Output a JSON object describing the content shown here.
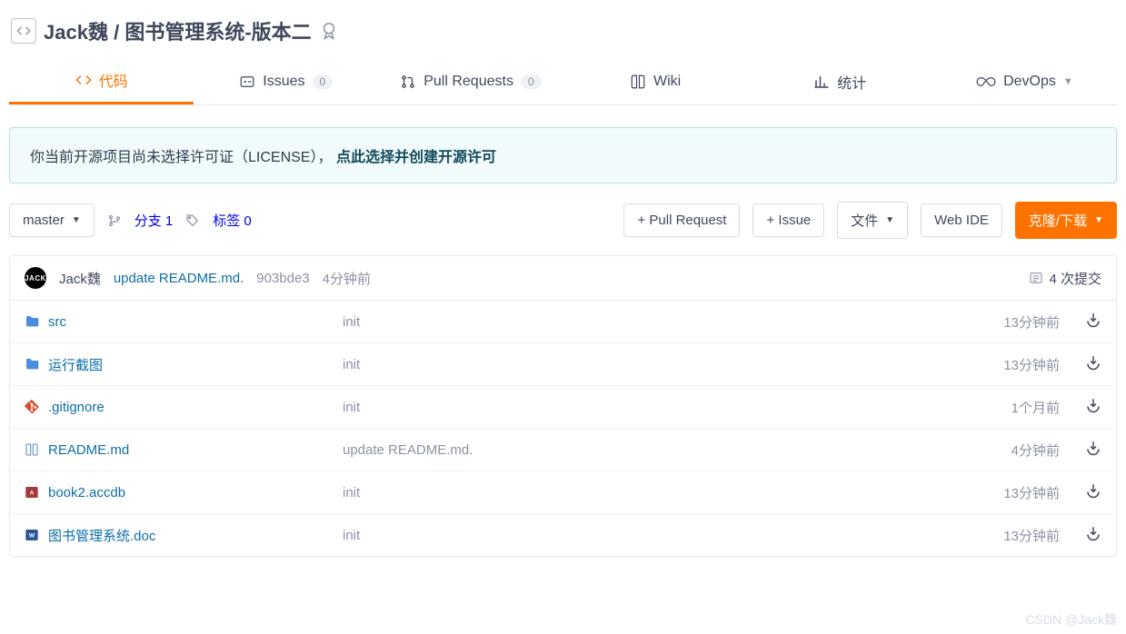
{
  "repo": {
    "owner": "Jack魏",
    "sep": "/",
    "name": "图书管理系统-版本二"
  },
  "tabs": {
    "code": "代码",
    "issues": "Issues",
    "issues_count": "0",
    "pr": "Pull Requests",
    "pr_count": "0",
    "wiki": "Wiki",
    "stats": "统计",
    "devops": "DevOps"
  },
  "notice": {
    "prefix": "你当前开源项目尚未选择许可证（LICENSE），",
    "action": "点此选择并创建开源许可"
  },
  "toolbar": {
    "branch_btn": "master",
    "branches_label": "分支 1",
    "tags_label": "标签 0",
    "new_pr": "+ Pull Request",
    "new_issue": "+ Issue",
    "files_btn": "文件",
    "webide": "Web IDE",
    "clone": "克隆/下载"
  },
  "latest": {
    "avatar_text": "JACK",
    "author": "Jack魏",
    "message": "update README.md.",
    "sha": "903bde3",
    "ago": "4分钟前",
    "commits_label": "4 次提交"
  },
  "files": [
    {
      "icon": "folder",
      "name": "src",
      "msg": "init",
      "time": "13分钟前"
    },
    {
      "icon": "folder",
      "name": "运行截图",
      "msg": "init",
      "time": "13分钟前"
    },
    {
      "icon": "git",
      "name": ".gitignore",
      "msg": "init",
      "time": "1个月前"
    },
    {
      "icon": "readme",
      "name": "README.md",
      "msg": "update README.md.",
      "time": "4分钟前"
    },
    {
      "icon": "access",
      "name": "book2.accdb",
      "msg": "init",
      "time": "13分钟前"
    },
    {
      "icon": "word",
      "name": "图书管理系统.doc",
      "msg": "init",
      "time": "13分钟前"
    }
  ],
  "watermark": "CSDN @Jack魏"
}
